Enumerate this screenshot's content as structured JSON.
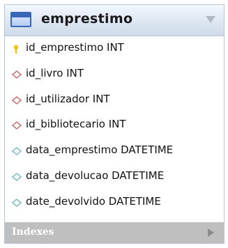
{
  "entity": {
    "title": "emprestimo",
    "columns": [
      {
        "label": "id_emprestimo INT",
        "icon": "key-icon"
      },
      {
        "label": "id_livro INT",
        "icon": "foreign-key-diamond-icon"
      },
      {
        "label": "id_utilizador INT",
        "icon": "foreign-key-diamond-icon"
      },
      {
        "label": "id_bibliotecario INT",
        "icon": "foreign-key-diamond-icon"
      },
      {
        "label": "data_emprestimo DATETIME",
        "icon": "column-diamond-icon"
      },
      {
        "label": "data_devolucao DATETIME",
        "icon": "column-diamond-icon"
      },
      {
        "label": "date_devolvido DATETIME",
        "icon": "column-diamond-icon"
      }
    ],
    "footer_label": "Indexes"
  },
  "colors": {
    "key": "#f2c200",
    "foreign_key": "#c86464",
    "column": "#6fb7b9"
  }
}
